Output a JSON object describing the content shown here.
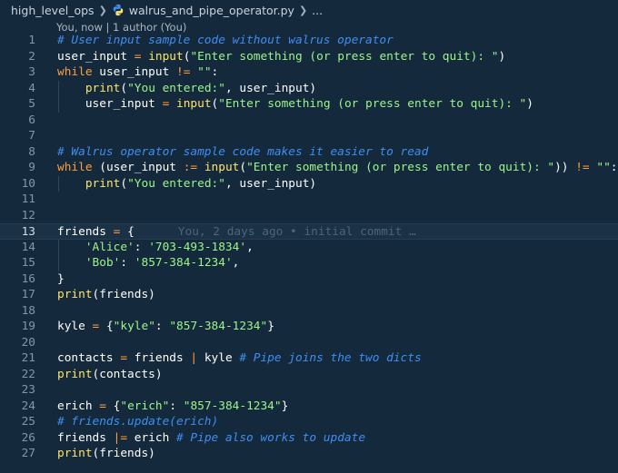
{
  "breadcrumb": {
    "folder": "high_level_ops",
    "file": "walrus_and_pipe_operator.py",
    "more": "..."
  },
  "codelens": "You, now | 1 author (You)",
  "current_line": 13,
  "lines": [
    {
      "n": 1,
      "tokens": [
        {
          "t": "# User input sample code without walrus operator",
          "c": "cmt"
        }
      ]
    },
    {
      "n": 2,
      "tokens": [
        {
          "t": "user_input ",
          "c": "var"
        },
        {
          "t": "=",
          "c": "op"
        },
        {
          "t": " ",
          "c": "pun"
        },
        {
          "t": "input",
          "c": "fn"
        },
        {
          "t": "(",
          "c": "pun"
        },
        {
          "t": "\"Enter something (or press enter to quit): \"",
          "c": "str"
        },
        {
          "t": ")",
          "c": "pun"
        }
      ]
    },
    {
      "n": 3,
      "tokens": [
        {
          "t": "while",
          "c": "kw"
        },
        {
          "t": " user_input ",
          "c": "var"
        },
        {
          "t": "!=",
          "c": "op"
        },
        {
          "t": " ",
          "c": "pun"
        },
        {
          "t": "\"\"",
          "c": "str"
        },
        {
          "t": ":",
          "c": "pun"
        }
      ]
    },
    {
      "n": 4,
      "indent": 1,
      "tokens": [
        {
          "t": "print",
          "c": "fn"
        },
        {
          "t": "(",
          "c": "pun"
        },
        {
          "t": "\"You entered:\"",
          "c": "str"
        },
        {
          "t": ", user_input)",
          "c": "var"
        }
      ]
    },
    {
      "n": 5,
      "indent": 1,
      "tokens": [
        {
          "t": "user_input ",
          "c": "var"
        },
        {
          "t": "=",
          "c": "op"
        },
        {
          "t": " ",
          "c": "pun"
        },
        {
          "t": "input",
          "c": "fn"
        },
        {
          "t": "(",
          "c": "pun"
        },
        {
          "t": "\"Enter something (or press enter to quit): \"",
          "c": "str"
        },
        {
          "t": ")",
          "c": "pun"
        }
      ]
    },
    {
      "n": 6,
      "tokens": []
    },
    {
      "n": 7,
      "tokens": []
    },
    {
      "n": 8,
      "tokens": [
        {
          "t": "# Walrus operator sample code makes it easier to read",
          "c": "cmt"
        }
      ]
    },
    {
      "n": 9,
      "tokens": [
        {
          "t": "while",
          "c": "kw"
        },
        {
          "t": " (user_input ",
          "c": "var"
        },
        {
          "t": ":=",
          "c": "op"
        },
        {
          "t": " ",
          "c": "pun"
        },
        {
          "t": "input",
          "c": "fn"
        },
        {
          "t": "(",
          "c": "pun"
        },
        {
          "t": "\"Enter something (or press enter to quit): \"",
          "c": "str"
        },
        {
          "t": ")) ",
          "c": "pun"
        },
        {
          "t": "!=",
          "c": "op"
        },
        {
          "t": " ",
          "c": "pun"
        },
        {
          "t": "\"\"",
          "c": "str"
        },
        {
          "t": ":",
          "c": "pun"
        }
      ]
    },
    {
      "n": 10,
      "indent": 1,
      "tokens": [
        {
          "t": "print",
          "c": "fn"
        },
        {
          "t": "(",
          "c": "pun"
        },
        {
          "t": "\"You entered:\"",
          "c": "str"
        },
        {
          "t": ", user_input)",
          "c": "var"
        }
      ]
    },
    {
      "n": 11,
      "tokens": []
    },
    {
      "n": 12,
      "tokens": []
    },
    {
      "n": 13,
      "tokens": [
        {
          "t": "friends ",
          "c": "var"
        },
        {
          "t": "=",
          "c": "op"
        },
        {
          "t": " {",
          "c": "pun"
        }
      ],
      "blame": "You, 2 days ago • initial commit …"
    },
    {
      "n": 14,
      "indent": 1,
      "tokens": [
        {
          "t": "'Alice'",
          "c": "str"
        },
        {
          "t": ": ",
          "c": "pun"
        },
        {
          "t": "'703-493-1834'",
          "c": "str"
        },
        {
          "t": ",",
          "c": "pun"
        }
      ]
    },
    {
      "n": 15,
      "indent": 1,
      "tokens": [
        {
          "t": "'Bob'",
          "c": "str"
        },
        {
          "t": ": ",
          "c": "pun"
        },
        {
          "t": "'857-384-1234'",
          "c": "str"
        },
        {
          "t": ",",
          "c": "pun"
        }
      ]
    },
    {
      "n": 16,
      "tokens": [
        {
          "t": "}",
          "c": "pun"
        }
      ]
    },
    {
      "n": 17,
      "tokens": [
        {
          "t": "print",
          "c": "fn"
        },
        {
          "t": "(friends)",
          "c": "var"
        }
      ]
    },
    {
      "n": 18,
      "tokens": []
    },
    {
      "n": 19,
      "tokens": [
        {
          "t": "kyle ",
          "c": "var"
        },
        {
          "t": "=",
          "c": "op"
        },
        {
          "t": " {",
          "c": "pun"
        },
        {
          "t": "\"kyle\"",
          "c": "str"
        },
        {
          "t": ": ",
          "c": "pun"
        },
        {
          "t": "\"857-384-1234\"",
          "c": "str"
        },
        {
          "t": "}",
          "c": "pun"
        }
      ]
    },
    {
      "n": 20,
      "tokens": []
    },
    {
      "n": 21,
      "tokens": [
        {
          "t": "contacts ",
          "c": "var"
        },
        {
          "t": "=",
          "c": "op"
        },
        {
          "t": " friends ",
          "c": "var"
        },
        {
          "t": "|",
          "c": "op"
        },
        {
          "t": " kyle ",
          "c": "var"
        },
        {
          "t": "# Pipe joins the two dicts",
          "c": "cmt"
        }
      ]
    },
    {
      "n": 22,
      "tokens": [
        {
          "t": "print",
          "c": "fn"
        },
        {
          "t": "(contacts)",
          "c": "var"
        }
      ]
    },
    {
      "n": 23,
      "tokens": []
    },
    {
      "n": 24,
      "tokens": [
        {
          "t": "erich ",
          "c": "var"
        },
        {
          "t": "=",
          "c": "op"
        },
        {
          "t": " {",
          "c": "pun"
        },
        {
          "t": "\"erich\"",
          "c": "str"
        },
        {
          "t": ": ",
          "c": "pun"
        },
        {
          "t": "\"857-384-1234\"",
          "c": "str"
        },
        {
          "t": "}",
          "c": "pun"
        }
      ]
    },
    {
      "n": 25,
      "tokens": [
        {
          "t": "# friends.update(erich)",
          "c": "cmt"
        }
      ]
    },
    {
      "n": 26,
      "tokens": [
        {
          "t": "friends ",
          "c": "var"
        },
        {
          "t": "|=",
          "c": "op"
        },
        {
          "t": " erich ",
          "c": "var"
        },
        {
          "t": "# Pipe also works to update",
          "c": "cmt"
        }
      ]
    },
    {
      "n": 27,
      "tokens": [
        {
          "t": "print",
          "c": "fn"
        },
        {
          "t": "(friends)",
          "c": "var"
        }
      ]
    }
  ]
}
